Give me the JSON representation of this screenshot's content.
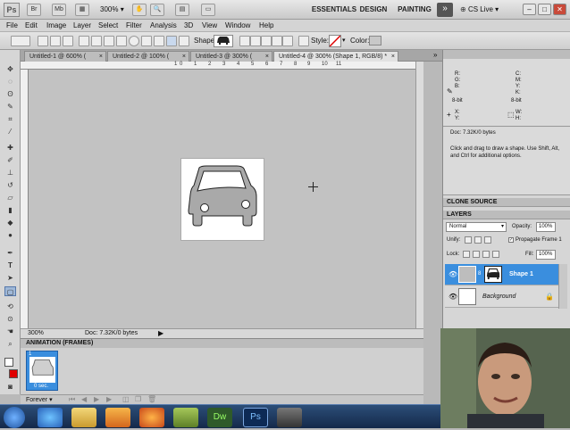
{
  "app": {
    "logo": "Ps",
    "zoom_select": "300%",
    "workspaces": [
      "ESSENTIALS",
      "DESIGN",
      "PAINTING"
    ],
    "more_label": "»",
    "cslive": "CS Live"
  },
  "menu": [
    "File",
    "Edit",
    "Image",
    "Layer",
    "Select",
    "Filter",
    "Analysis",
    "3D",
    "View",
    "Window",
    "Help"
  ],
  "options": {
    "shape_label": "Shape:",
    "style_label": "Style:",
    "color_label": "Color:"
  },
  "tabs": [
    {
      "label": "Untitled-1 @ 600% (",
      "active": false
    },
    {
      "label": "Untitled-2 @ 100% (",
      "active": false
    },
    {
      "label": "Untitled-3 @ 300% (",
      "active": false
    },
    {
      "label": "Untitled-4 @ 300% (Shape 1, RGB/8) *",
      "active": true
    }
  ],
  "ruler_h": [
    "1",
    "0",
    "1",
    "2",
    "3",
    "4",
    "5",
    "6",
    "7",
    "8",
    "9",
    "10",
    "11"
  ],
  "status": {
    "zoom": "300%",
    "doc": "Doc: 7.32K/0 bytes"
  },
  "animation": {
    "title": "ANIMATION (FRAMES)",
    "frame_number": "1",
    "frame_time": "0 sec.",
    "loop": "Forever"
  },
  "info": {
    "r": "R:",
    "g": "G:",
    "b": "B:",
    "c": "C:",
    "m": "M:",
    "y": "Y:",
    "k": "K:",
    "bit_left": "8-bit",
    "bit_right": "8-bit",
    "x": "X:",
    "y_coord": "Y:",
    "w": "W:",
    "h": "H:",
    "doc": "Doc: 7.32K/0 bytes",
    "hint": "Click and drag to draw a shape.  Use Shift, Alt, and Ctrl for additional options."
  },
  "clone_source": "CLONE SOURCE",
  "layers": {
    "title": "LAYERS",
    "blend": "Normal",
    "opacity_label": "Opacity:",
    "opacity": "100%",
    "unify_label": "Unify:",
    "propagate": "Propagate Frame 1",
    "lock_label": "Lock:",
    "fill_label": "Fill:",
    "fill": "100%",
    "items": [
      {
        "name": "Shape 1",
        "selected": true
      },
      {
        "name": "Background",
        "selected": false
      }
    ]
  },
  "colors": {
    "accent": "#3a8ede",
    "fg_swatch": "#e00000",
    "bg_swatch": "#ffffff"
  }
}
